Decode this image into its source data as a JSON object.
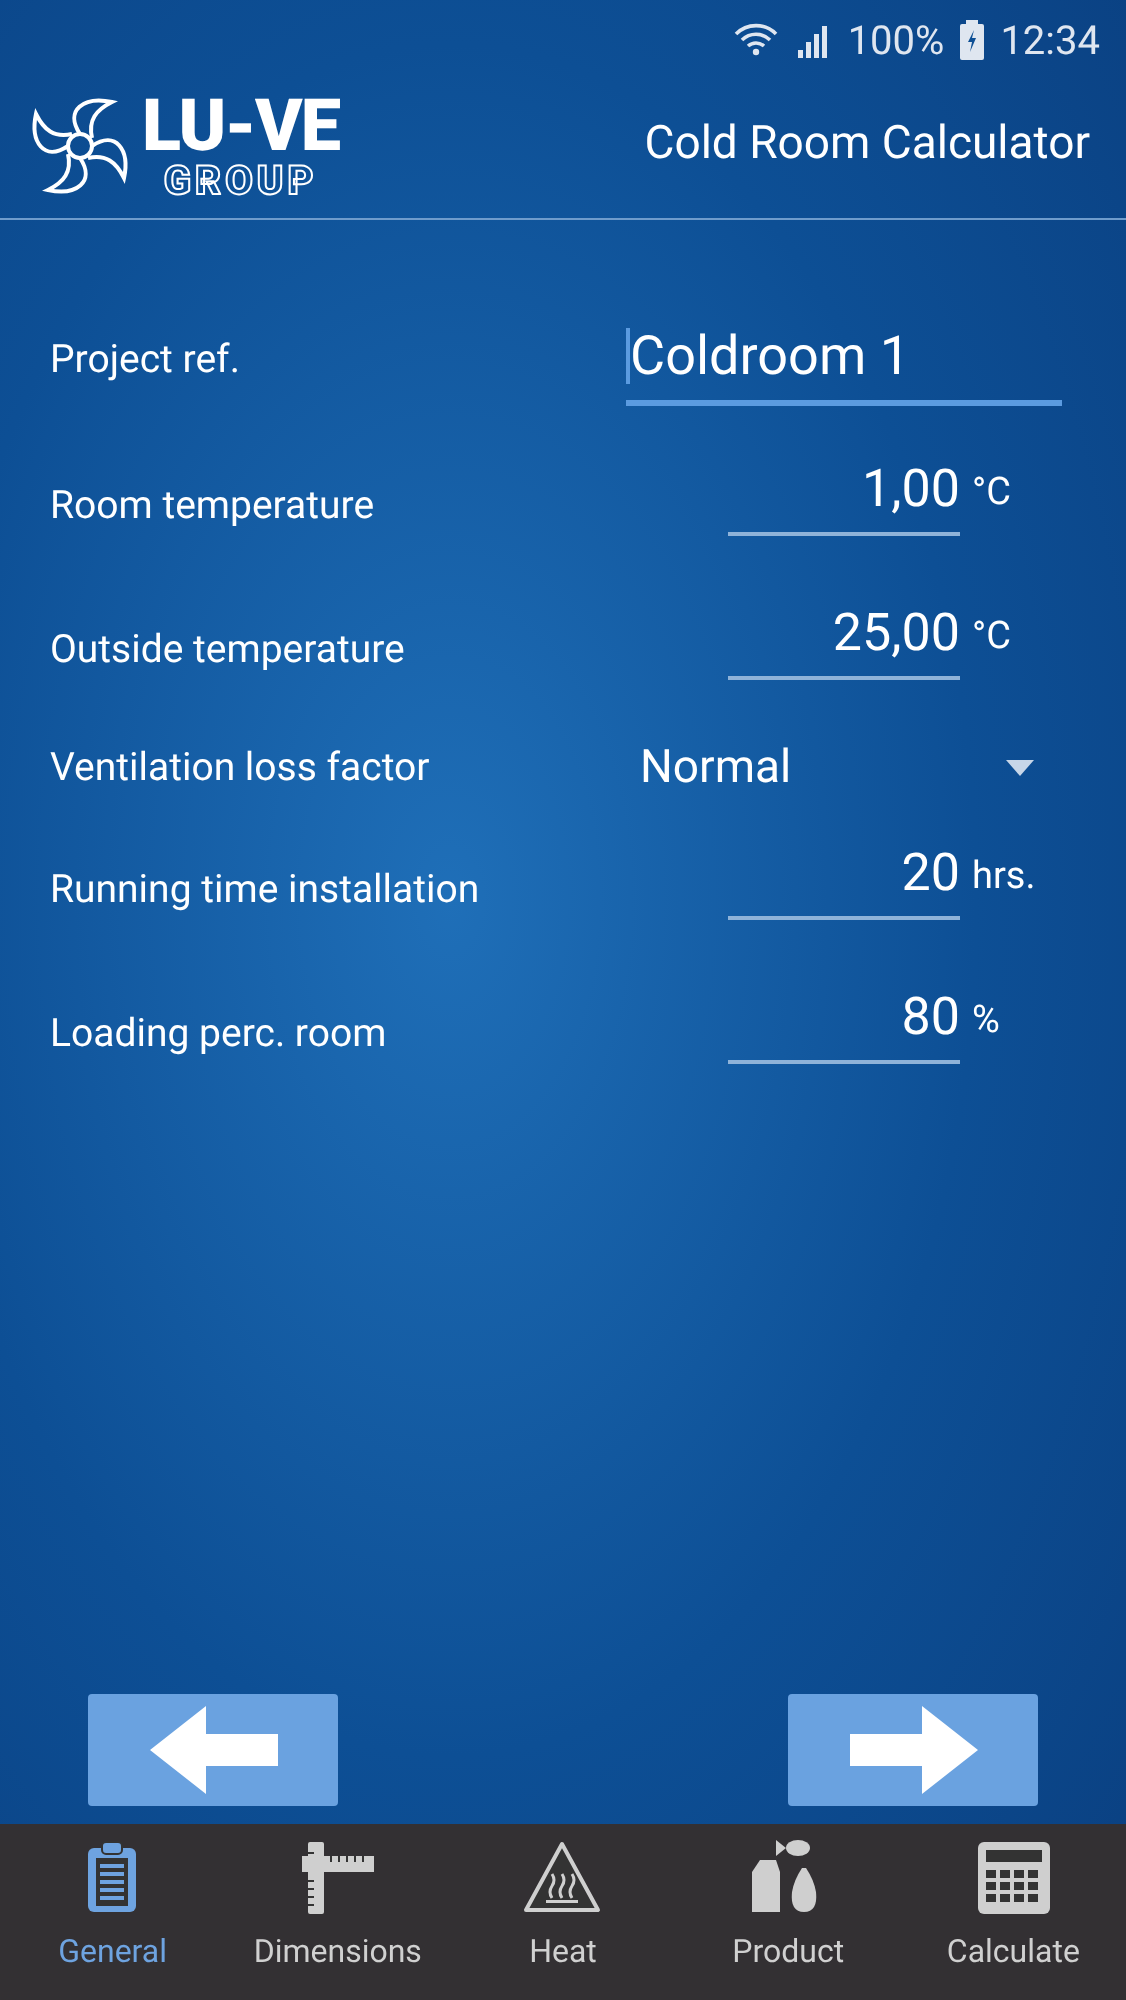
{
  "status_bar": {
    "battery": "100%",
    "time": "12:34"
  },
  "header": {
    "logo_main": "LU-VE",
    "logo_sub": "GROUP",
    "title": "Cold Room Calculator"
  },
  "fields": [
    {
      "kind": "text",
      "label": "Project ref.",
      "value": "Coldroom 1",
      "focused": true
    },
    {
      "kind": "number",
      "label": "Room temperature",
      "value": "1,00",
      "unit": "°C"
    },
    {
      "kind": "number",
      "label": "Outside temperature",
      "value": "25,00",
      "unit": "°C"
    },
    {
      "kind": "select",
      "label": "Ventilation loss factor",
      "value": "Normal"
    },
    {
      "kind": "number",
      "label": "Running time installation",
      "value": "20",
      "unit": "hrs."
    },
    {
      "kind": "number",
      "label": "Loading perc. room",
      "value": "80",
      "unit": "%"
    }
  ],
  "nav_tabs": [
    {
      "kind": "clipboard",
      "label": "General",
      "selected": true
    },
    {
      "kind": "ruler",
      "label": "Dimensions",
      "selected": false
    },
    {
      "kind": "heat",
      "label": "Heat",
      "selected": false
    },
    {
      "kind": "food",
      "label": "Product",
      "selected": false
    },
    {
      "kind": "calculator",
      "label": "Calculate",
      "selected": false
    }
  ]
}
